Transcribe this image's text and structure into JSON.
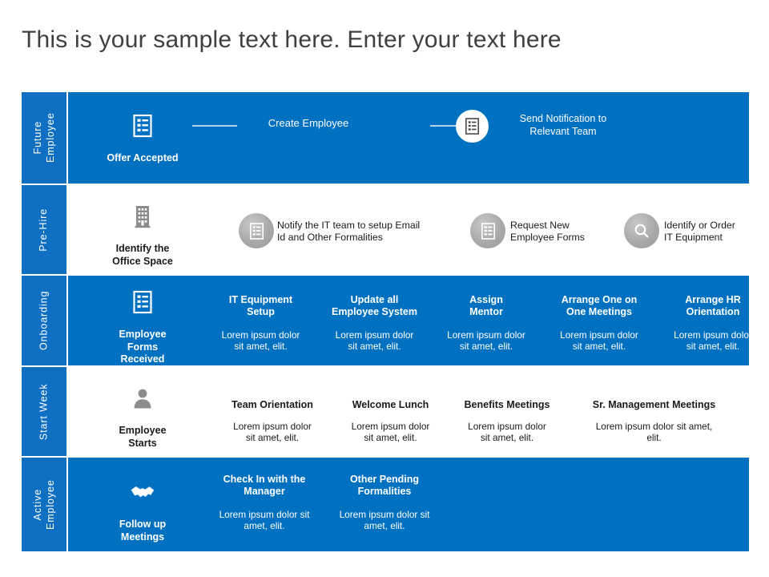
{
  "slide": {
    "title": "This is your sample text here. Enter your text here",
    "colors": {
      "primary_blue": "#0070c0",
      "label_blue": "#0f6fc2",
      "white": "#ffffff",
      "gray_icon": "#8c8c8c",
      "title_text": "#404040"
    }
  },
  "rows": [
    {
      "label": "Future\nEmployee",
      "label_line1": "Future",
      "label_line2": "Employee",
      "background": "blue",
      "stage": {
        "icon": "clipboard-list-icon",
        "label": "Offer Accepted"
      },
      "items": [
        {
          "title": "Create Employee",
          "desc": "",
          "icon": ""
        },
        {
          "title": "Send Notification to\nRelevant Team",
          "title_line1": "Send Notification to",
          "title_line2": "Relevant Team",
          "desc": "",
          "icon": "clipboard-list-icon"
        }
      ]
    },
    {
      "label": "Pre-Hire",
      "label_line1": "Pre-Hire",
      "label_line2": "",
      "background": "white",
      "stage": {
        "icon": "office-building-icon",
        "label": "Identify  the\nOffice Space",
        "label_line1": "Identify  the",
        "label_line2": "Office Space"
      },
      "items": [
        {
          "title": "Notify the IT team to setup Email\nId and Other Formalities",
          "title_line1": "Notify the IT team to setup Email",
          "title_line2": "Id and Other Formalities",
          "icon": "clipboard-list-icon"
        },
        {
          "title": "Request New\nEmployee Forms",
          "title_line1": "Request New",
          "title_line2": "Employee Forms",
          "icon": "clipboard-list-icon"
        },
        {
          "title": "Identify or Order\nIT Equipment",
          "title_line1": "Identify or Order",
          "title_line2": "IT Equipment",
          "icon": "search-icon"
        }
      ]
    },
    {
      "label": "Onboarding",
      "label_line1": "Onboarding",
      "label_line2": "",
      "background": "blue",
      "stage": {
        "icon": "clipboard-list-icon",
        "label": "Employee\nForms\nReceived",
        "label_line1": "Employee",
        "label_line2": "Forms",
        "label_line3": "Received"
      },
      "items": [
        {
          "title": "IT Equipment\nSetup",
          "title_line1": "IT Equipment",
          "title_line2": "Setup",
          "desc": "Lorem ipsum dolor\nsit amet, elit.",
          "desc_line1": "Lorem ipsum dolor",
          "desc_line2": "sit amet, elit."
        },
        {
          "title": "Update all\nEmployee System",
          "title_line1": "Update all",
          "title_line2": "Employee System",
          "desc": "Lorem ipsum dolor\nsit amet, elit.",
          "desc_line1": "Lorem ipsum dolor",
          "desc_line2": "sit amet, elit."
        },
        {
          "title": "Assign\nMentor",
          "title_line1": "Assign",
          "title_line2": "Mentor",
          "desc": "Lorem ipsum dolor\nsit amet, elit.",
          "desc_line1": "Lorem ipsum dolor",
          "desc_line2": "sit amet, elit."
        },
        {
          "title": "Arrange One on\nOne  Meetings",
          "title_line1": "Arrange One on",
          "title_line2": "One  Meetings",
          "desc": "Lorem ipsum dolor\nsit amet, elit.",
          "desc_line1": "Lorem ipsum dolor",
          "desc_line2": "sit amet, elit."
        },
        {
          "title": "Arrange HR\nOrientation",
          "title_line1": "Arrange HR",
          "title_line2": "Orientation",
          "desc": "Lorem ipsum dolor\nsit amet, elit.",
          "desc_line1": "Lorem ipsum dolor",
          "desc_line2": "sit amet, elit."
        }
      ]
    },
    {
      "label": "Start Week",
      "label_line1": "Start Week",
      "label_line2": "",
      "background": "white",
      "stage": {
        "icon": "person-icon",
        "label": "Employee\nStarts",
        "label_line1": "Employee",
        "label_line2": "Starts"
      },
      "items": [
        {
          "title": "Team Orientation",
          "desc": "Lorem ipsum dolor\nsit amet, elit.",
          "desc_line1": "Lorem ipsum dolor",
          "desc_line2": "sit amet, elit."
        },
        {
          "title": "Welcome Lunch",
          "desc": "Lorem ipsum dolor\nsit amet, elit.",
          "desc_line1": "Lorem ipsum dolor",
          "desc_line2": "sit amet, elit."
        },
        {
          "title": "Benefits Meetings",
          "desc": "Lorem ipsum dolor\nsit amet, elit.",
          "desc_line1": "Lorem ipsum dolor",
          "desc_line2": "sit amet, elit."
        },
        {
          "title": "Sr. Management Meetings",
          "desc": "Lorem ipsum dolor sit amet,\nelit.",
          "desc_line1": "Lorem ipsum dolor sit amet,",
          "desc_line2": "elit."
        }
      ]
    },
    {
      "label": "Active\nEmployee",
      "label_line1": "Active",
      "label_line2": "Employee",
      "background": "blue",
      "stage": {
        "icon": "handshake-icon",
        "label": "Follow up\nMeetings",
        "label_line1": "Follow up",
        "label_line2": "Meetings"
      },
      "items": [
        {
          "title": "Check In with the\nManager",
          "title_line1": "Check In with the",
          "title_line2": "Manager",
          "desc": "Lorem ipsum dolor sit\namet, elit.",
          "desc_line1": "Lorem ipsum dolor sit",
          "desc_line2": "amet, elit."
        },
        {
          "title": "Other Pending\nFormalities",
          "title_line1": "Other Pending",
          "title_line2": "Formalities",
          "desc": "Lorem ipsum dolor sit\namet, elit.",
          "desc_line1": "Lorem ipsum dolor sit",
          "desc_line2": "amet, elit."
        }
      ]
    }
  ]
}
